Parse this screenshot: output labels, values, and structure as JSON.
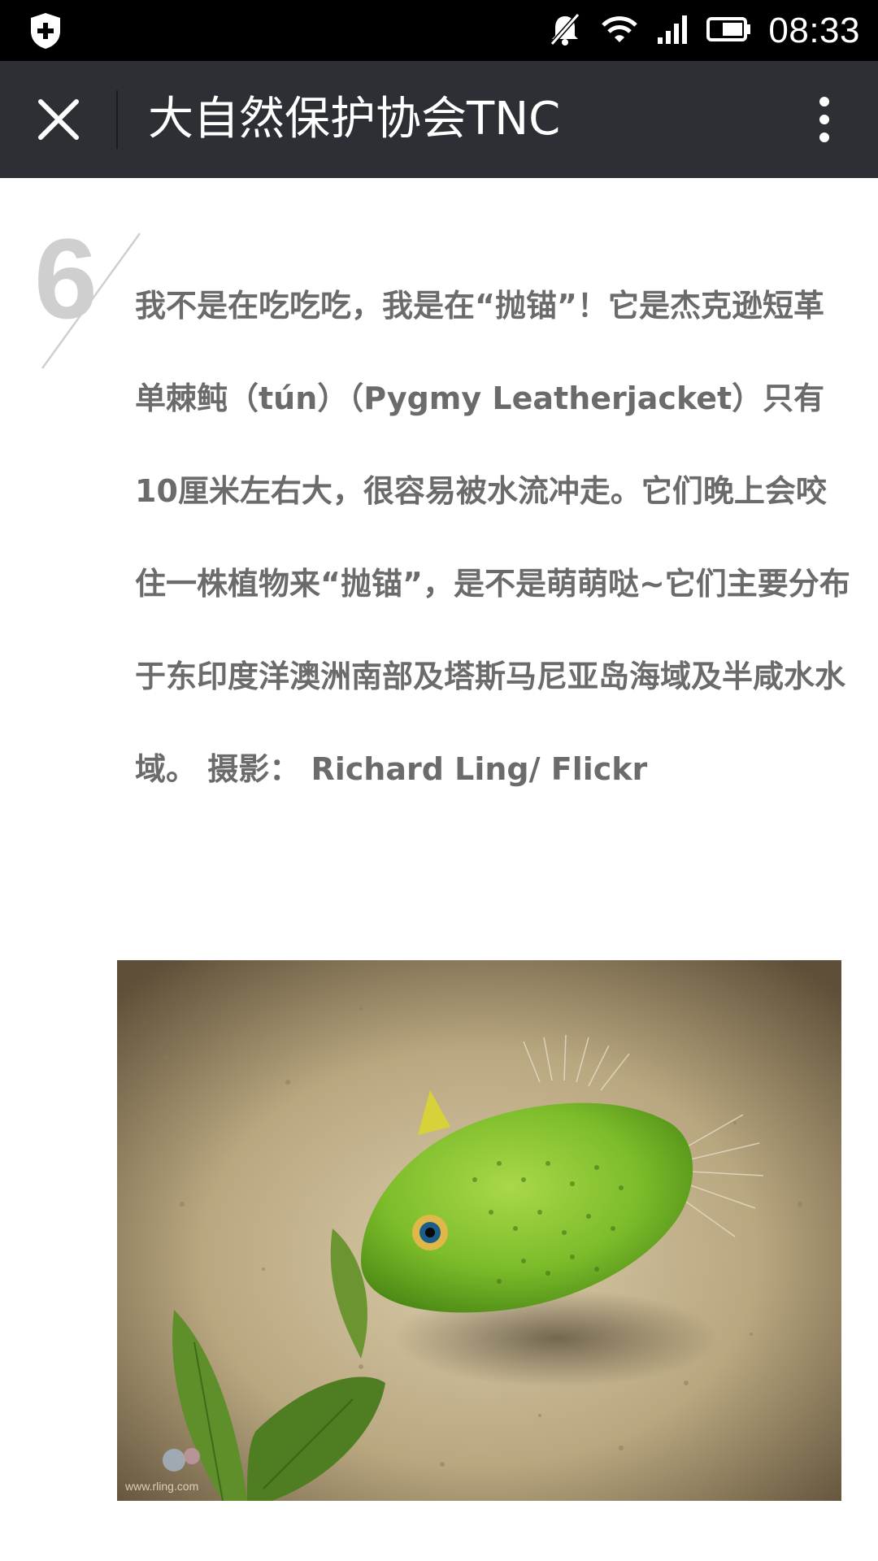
{
  "status_bar": {
    "time": "08:33",
    "icons": [
      "shield-plus-icon",
      "bell-muted-icon",
      "wifi-icon",
      "signal-icon",
      "battery-icon"
    ]
  },
  "app_bar": {
    "title": "大自然保护协会TNC",
    "close_icon": "close-icon",
    "more_icon": "more-vertical-icon"
  },
  "article": {
    "section_number": "6",
    "text": "我不是在吃吃吃，我是在“抛锚”！它是杰克逊短革单棘鲀（tún）（Pygmy Leatherjacket）只有10厘米左右大，很容易被水流冲走。它们晚上会咬住一株植物来“抛锚”，是不是萌萌哒~它们主要分布于东印度洋澳洲南部及塔斯马尼亚岛海域及半咸水水域。 摄影： Richard Ling/ Flickr",
    "photo": {
      "watermark": "www.rling.com"
    }
  },
  "colors": {
    "status_bar_bg": "#000000",
    "app_bar_bg": "#2c2f33",
    "text": "#6b6b6b",
    "number": "#cfcfcf"
  }
}
